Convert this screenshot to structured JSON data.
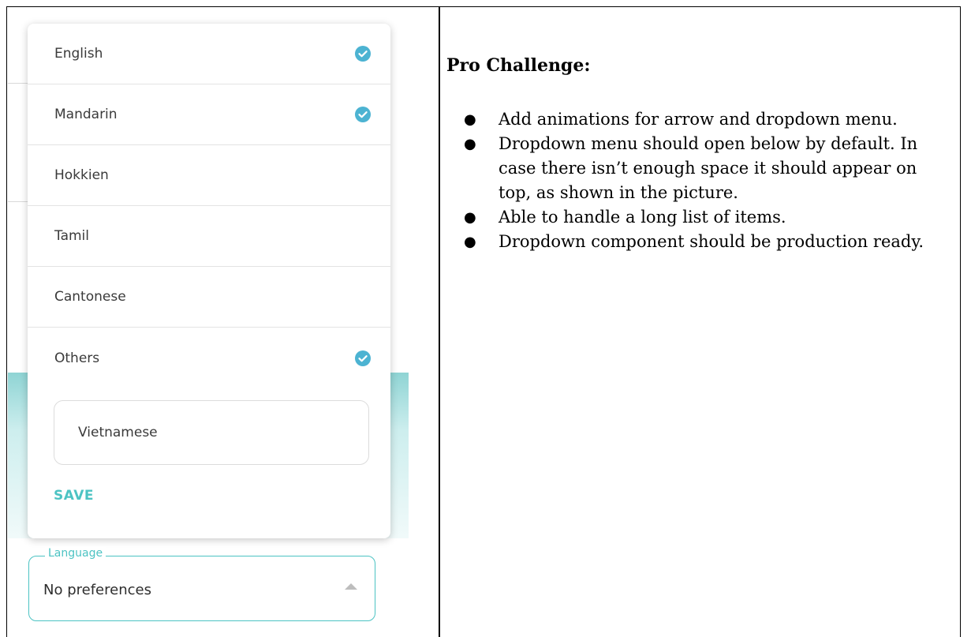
{
  "dropdown": {
    "options": [
      {
        "label": "English",
        "checked": true
      },
      {
        "label": "Mandarin",
        "checked": true
      },
      {
        "label": "Hokkien",
        "checked": false
      },
      {
        "label": "Tamil",
        "checked": false
      },
      {
        "label": "Cantonese",
        "checked": false
      },
      {
        "label": "Others",
        "checked": true
      }
    ],
    "other_input_value": "Vietnamese",
    "save_label": "SAVE"
  },
  "language_field": {
    "legend": "Language",
    "value": "No preferences"
  },
  "pro_challenge": {
    "title": "Pro Challenge:",
    "items": [
      "Add animations for arrow and dropdown menu.",
      "Dropdown menu should open below by default. In case there isn’t enough space it should appear on top, as shown in the picture.",
      "Able to handle a long list of items.",
      "Dropdown component should be production ready."
    ]
  },
  "colors": {
    "accent": "#4cc3c3",
    "check": "#4cb3d2"
  },
  "icons": {
    "check": "check-circle-icon",
    "arrow": "arrow-up-icon",
    "bullet": "bullet-icon"
  }
}
